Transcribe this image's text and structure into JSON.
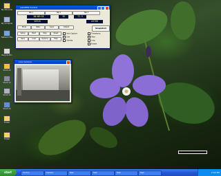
{
  "desktop": {
    "icons": [
      {
        "label": "My Documents",
        "icon": "folder-icon"
      },
      {
        "label": "My Computer",
        "icon": "computer-icon"
      },
      {
        "label": "Network Places",
        "icon": "network-icon"
      },
      {
        "label": "Recycle Bin",
        "icon": "recycle-bin-icon"
      },
      {
        "label": "Shortcut",
        "icon": "shortcut-icon"
      },
      {
        "label": "Shortcut",
        "icon": "shortcut-icon"
      },
      {
        "label": "Shortcut",
        "icon": "shortcut-icon"
      },
      {
        "label": "Shortcut",
        "icon": "shortcut-icon"
      },
      {
        "label": "Folder",
        "icon": "folder-icon"
      },
      {
        "label": "Folder",
        "icon": "folder-icon"
      }
    ]
  },
  "main_window": {
    "title": "LabVIEW Control",
    "tabs": [
      "Tab 1",
      "Tab 2",
      "Tab 3"
    ],
    "lcd_time": "14:02:11",
    "lcd_a": "38",
    "lcd_b": "72.9",
    "lcd_c": "56928",
    "lcd_d": "A3788",
    "dropdowns": [
      "Mode",
      "Rate",
      "Input",
      "Output"
    ],
    "snapshot_label": "Snapshot",
    "buttons": [
      "Setup",
      "Start",
      "Stop",
      "Reset",
      "Save",
      "Load",
      "Options",
      "Help"
    ],
    "checks": [
      "Auto Capture",
      "Grid",
      "Overlay",
      "Timestamp",
      "Filter",
      "Loop",
      "Enable"
    ]
  },
  "camera_window": {
    "title": "Live Camera"
  },
  "taskbar": {
    "start_label": "start",
    "tasks": [
      "Control",
      "Camera",
      "Task",
      "Task",
      "Task",
      "Task"
    ],
    "clock": "2:02 PM"
  },
  "colors": {
    "titlebar": "#0a5ae8",
    "lcd_bg": "#04103a",
    "lcd_fg": "#f2f28a",
    "petal": "#8f73d8",
    "taskbar": "#2458d6",
    "start": "#3aa43e"
  }
}
